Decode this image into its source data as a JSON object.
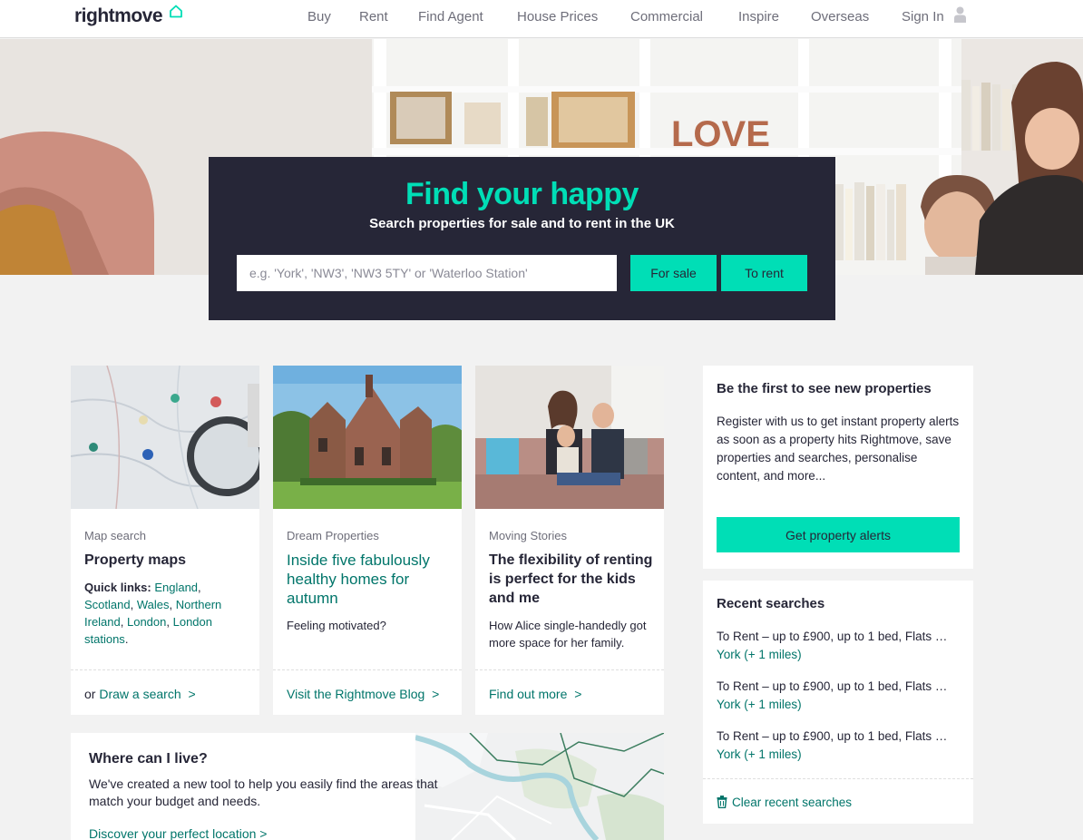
{
  "header": {
    "logo": "rightmove",
    "nav": [
      {
        "label": "Buy"
      },
      {
        "label": "Rent"
      },
      {
        "label": "Find Agent"
      },
      {
        "label": "House Prices"
      },
      {
        "label": "Commercial"
      },
      {
        "label": "Inspire"
      },
      {
        "label": "Overseas"
      },
      {
        "label": "Sign In"
      }
    ],
    "user_icon": "user-icon"
  },
  "hero": {
    "title": "Find your happy",
    "subtitle": "Search properties for sale and to rent in the UK",
    "search_placeholder": "e.g. 'York', 'NW3', 'NW3 5TY' or 'Waterloo Station'",
    "for_sale_label": "For sale",
    "to_rent_label": "To rent",
    "shelf_word": "LOVE"
  },
  "cards": [
    {
      "category": "Map search",
      "title": "Property maps",
      "quick_links_label": "Quick links:",
      "quick_links": [
        "England",
        "Scotland",
        "Wales",
        "Northern Ireland",
        "London",
        "London stations"
      ],
      "footer_prefix": "or ",
      "footer_link": "Draw a search",
      "footer_arrow": ">"
    },
    {
      "category": "Dream Properties",
      "title": "Inside five fabulously healthy homes for autumn",
      "body": "Feeling motivated?",
      "footer_link": "Visit the Rightmove Blog",
      "footer_arrow": ">"
    },
    {
      "category": "Moving Stories",
      "title": "The flexibility of renting is perfect for the kids and me",
      "body": "How Alice single-handedly got more space for her family.",
      "footer_link": "Find out more",
      "footer_arrow": ">"
    }
  ],
  "alerts_panel": {
    "title": "Be the first to see new properties",
    "text": "Register with us to get instant property alerts as soon as a property hits Rightmove, save properties and searches, personalise content, and more...",
    "button": "Get property alerts"
  },
  "recent_searches": {
    "title": "Recent searches",
    "items": [
      {
        "desc": "To Rent – up to £900, up to 1 bed, Flats …",
        "location": "York (+ 1 miles)"
      },
      {
        "desc": "To Rent – up to £900, up to 1 bed, Flats …",
        "location": "York (+ 1 miles)"
      },
      {
        "desc": "To Rent – up to £900, up to 1 bed, Flats …",
        "location": "York (+ 1 miles)"
      }
    ],
    "clear_label": "Clear recent searches"
  },
  "where_can_i_live": {
    "title": "Where can I live?",
    "text": "We've created a new tool to help you easily find the areas that match your budget and needs.",
    "link": "Discover your perfect location >"
  },
  "colors": {
    "brand_green": "#00deb6",
    "dark_navy": "#262637",
    "link_teal": "#00756a"
  }
}
